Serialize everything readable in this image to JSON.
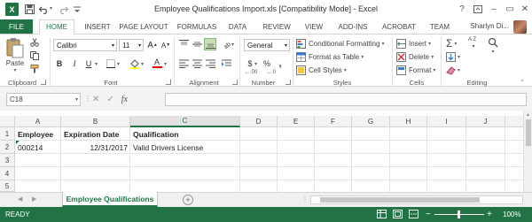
{
  "window": {
    "title": "Employee Qualifications Import.xls  [Compatibility Mode] - Excel",
    "app_logo": "X",
    "help": "?",
    "minimize": "–",
    "restore": "▭",
    "close": "✕"
  },
  "tabs": {
    "file": "FILE",
    "items": [
      "HOME",
      "INSERT",
      "PAGE LAYOUT",
      "FORMULAS",
      "DATA",
      "REVIEW",
      "VIEW",
      "ADD-INS",
      "ACROBAT",
      "TEAM"
    ],
    "active": "HOME",
    "user_name": "Sharlyn Di..."
  },
  "ribbon": {
    "clipboard": {
      "paste_label": "Paste",
      "group_label": "Clipboard"
    },
    "font": {
      "name": "Calibri",
      "size": "11",
      "group_label": "Font",
      "bold": "B",
      "italic": "I",
      "underline": "U",
      "grow": "A",
      "shrink": "A"
    },
    "alignment": {
      "group_label": "Alignment"
    },
    "number": {
      "format": "General",
      "currency": "$",
      "percent": "%",
      "comma": ",",
      "group_label": "Number",
      "inc_dec": ".00",
      "dec_dec": ".0"
    },
    "styles": {
      "conditional": "Conditional Formatting",
      "format_table": "Format as Table",
      "cell_styles": "Cell Styles",
      "group_label": "Styles"
    },
    "cells": {
      "insert": "Insert",
      "delete": "Delete",
      "format": "Format",
      "group_label": "Cells"
    },
    "editing": {
      "group_label": "Editing",
      "sum": "Σ",
      "sort": "A Z"
    }
  },
  "formula_bar": {
    "name_box": "C18",
    "cancel": "✕",
    "enter": "✓",
    "fx": "fx",
    "value": ""
  },
  "sheet": {
    "columns": [
      "A",
      "B",
      "C",
      "D",
      "E",
      "F",
      "G",
      "H",
      "I",
      "J"
    ],
    "selected_column": "C",
    "rows": [
      "1",
      "2",
      "3",
      "4",
      "5"
    ],
    "cells": {
      "A1": "Employee",
      "B1": "Expiration Date",
      "C1": "Qualification",
      "A2": "000214",
      "B2": "12/31/2017",
      "C2": "Valid Drivers License"
    }
  },
  "sheet_tabs": {
    "active": "Employee Qualifications",
    "add": "+",
    "nav_prev": "◀",
    "nav_next": "▶"
  },
  "status": {
    "ready": "READY",
    "zoom": "100%",
    "zoom_out": "−",
    "zoom_in": "+"
  },
  "colors": {
    "excel_green": "#217346"
  }
}
